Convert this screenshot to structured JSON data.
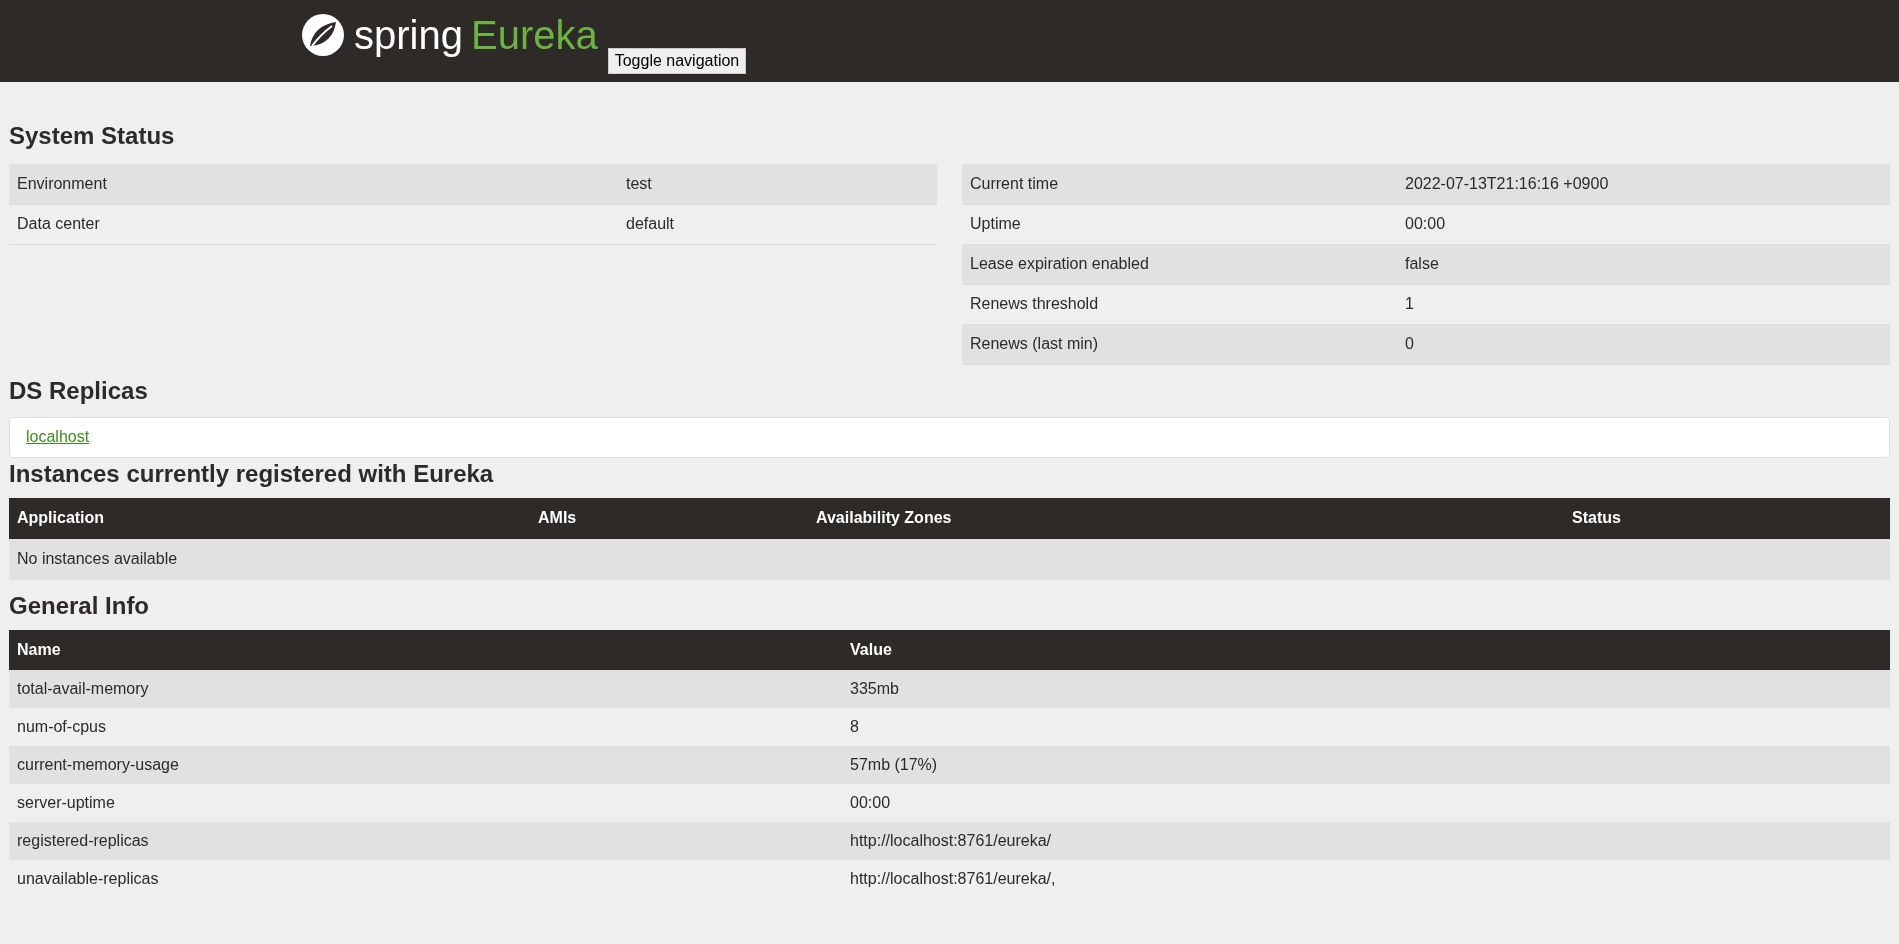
{
  "header": {
    "logo": {
      "brand": "spring",
      "product": "Eureka"
    },
    "toggle_button": "Toggle navigation"
  },
  "system_status": {
    "title": "System Status",
    "left_rows": [
      {
        "label": "Environment",
        "value": "test"
      },
      {
        "label": "Data center",
        "value": "default"
      }
    ],
    "right_rows": [
      {
        "label": "Current time",
        "value": "2022-07-13T21:16:16 +0900"
      },
      {
        "label": "Uptime",
        "value": "00:00"
      },
      {
        "label": "Lease expiration enabled",
        "value": "false"
      },
      {
        "label": "Renews threshold",
        "value": "1"
      },
      {
        "label": "Renews (last min)",
        "value": "0"
      }
    ]
  },
  "ds_replicas": {
    "title": "DS Replicas",
    "links": [
      "localhost"
    ]
  },
  "instances": {
    "title": "Instances currently registered with Eureka",
    "columns": [
      "Application",
      "AMIs",
      "Availability Zones",
      "Status"
    ],
    "empty_message": "No instances available"
  },
  "general_info": {
    "title": "General Info",
    "columns": [
      "Name",
      "Value"
    ],
    "rows": [
      {
        "name": "total-avail-memory",
        "value": "335mb"
      },
      {
        "name": "num-of-cpus",
        "value": "8"
      },
      {
        "name": "current-memory-usage",
        "value": "57mb (17%)"
      },
      {
        "name": "server-uptime",
        "value": "00:00"
      },
      {
        "name": "registered-replicas",
        "value": "http://localhost:8761/eureka/"
      },
      {
        "name": "unavailable-replicas",
        "value": "http://localhost:8761/eureka/,"
      }
    ]
  }
}
